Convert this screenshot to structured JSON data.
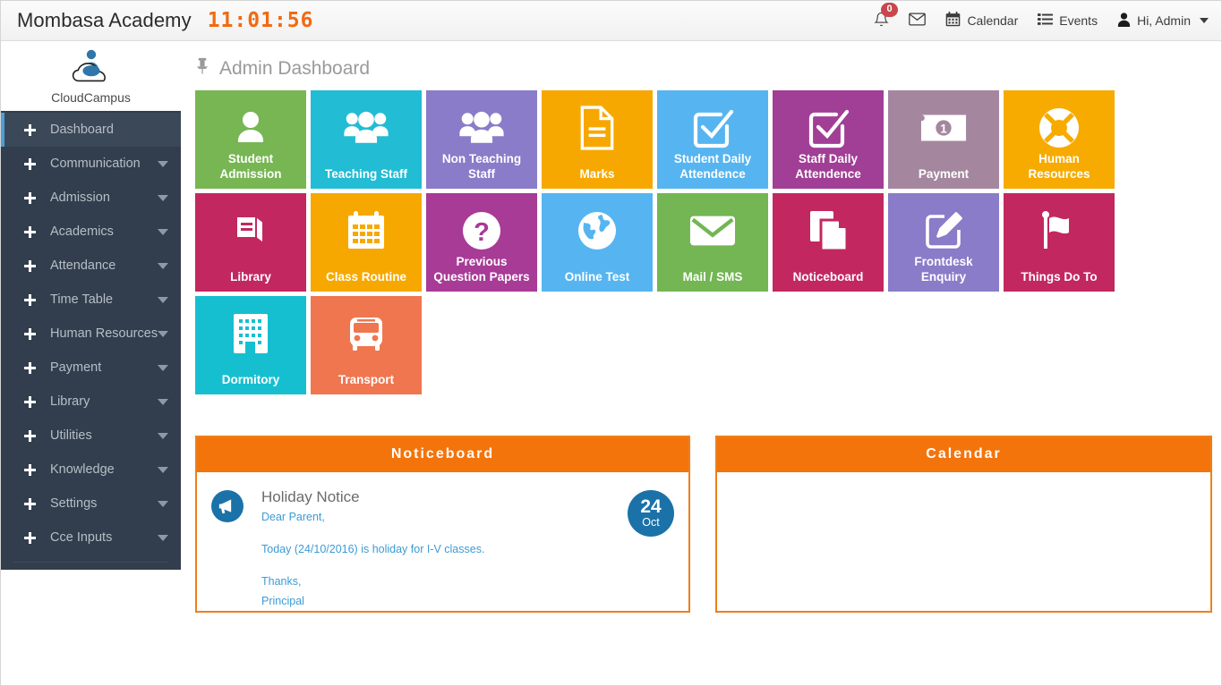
{
  "header": {
    "brand": "Mombasa Academy",
    "clock": "11:01:56",
    "notifications_count": "0",
    "notifications_icon": "bell-icon",
    "mail_icon": "envelope-icon",
    "calendar_label": "Calendar",
    "calendar_icon": "calendar-icon",
    "events_label": "Events",
    "events_icon": "list-icon",
    "user_label": "Hi, Admin",
    "user_icon": "user-icon"
  },
  "sidebar": {
    "logo_name": "CloudCampus",
    "logo_icon": "cloudcampus-logo-icon",
    "items": [
      {
        "label": "Dashboard",
        "active": true,
        "caret": false
      },
      {
        "label": "Communication",
        "active": false,
        "caret": true
      },
      {
        "label": "Admission",
        "active": false,
        "caret": true
      },
      {
        "label": "Academics",
        "active": false,
        "caret": true
      },
      {
        "label": "Attendance",
        "active": false,
        "caret": true
      },
      {
        "label": "Time Table",
        "active": false,
        "caret": true
      },
      {
        "label": "Human Resources",
        "active": false,
        "caret": true
      },
      {
        "label": "Payment",
        "active": false,
        "caret": true
      },
      {
        "label": "Library",
        "active": false,
        "caret": true
      },
      {
        "label": "Utilities",
        "active": false,
        "caret": true
      },
      {
        "label": "Knowledge",
        "active": false,
        "caret": true
      },
      {
        "label": "Settings",
        "active": false,
        "caret": true
      },
      {
        "label": "Cce Inputs",
        "active": false,
        "caret": true
      }
    ]
  },
  "main": {
    "page_title": "Admin Dashboard",
    "page_title_icon": "pin-icon",
    "tiles": [
      {
        "label": "Student Admission",
        "color": "#77b653",
        "icon": "user-icon"
      },
      {
        "label": "Teaching Staff",
        "color": "#22bcd4",
        "icon": "group-icon"
      },
      {
        "label": "Non Teaching Staff",
        "color": "#8a7cc8",
        "icon": "group-icon"
      },
      {
        "label": "Marks",
        "color": "#f7a800",
        "icon": "document-icon"
      },
      {
        "label": "Student Daily Attendence",
        "color": "#56b5f0",
        "icon": "checkbox-icon"
      },
      {
        "label": "Staff Daily Attendence",
        "color": "#a13e95",
        "icon": "checkbox-icon"
      },
      {
        "label": "Payment",
        "color": "#a4879f",
        "icon": "banknote-icon"
      },
      {
        "label": "Human Resources",
        "color": "#f7ab00",
        "icon": "lifebuoy-icon"
      },
      {
        "label": "Library",
        "color": "#c2285f",
        "icon": "book-icon"
      },
      {
        "label": "Class Routine",
        "color": "#f7a800",
        "icon": "calendar-icon"
      },
      {
        "label": "Previous Question Papers",
        "color": "#a73b96",
        "icon": "question-icon"
      },
      {
        "label": "Online Test",
        "color": "#56b5f0",
        "icon": "globe-icon"
      },
      {
        "label": "Mail / SMS",
        "color": "#73b653",
        "icon": "envelope-icon"
      },
      {
        "label": "Noticeboard",
        "color": "#c2285f",
        "icon": "copy-icon"
      },
      {
        "label": "Frontdesk Enquiry",
        "color": "#8a7cc8",
        "icon": "edit-icon"
      },
      {
        "label": "Things Do To",
        "color": "#c2285f",
        "icon": "flag-icon"
      },
      {
        "label": "Dormitory",
        "color": "#16bfd0",
        "icon": "building-icon"
      },
      {
        "label": "Transport",
        "color": "#f0764f",
        "icon": "bus-icon"
      }
    ],
    "noticeboard": {
      "title": "Noticeboard",
      "icon": "megaphone-icon",
      "notice_title": "Holiday Notice",
      "notice_greeting": "Dear Parent,",
      "notice_body": "Today (24/10/2016) is holiday for I-V classes.",
      "notice_thanks": "Thanks,",
      "notice_signature": "Principal",
      "date_day": "24",
      "date_month": "Oct"
    },
    "calendar": {
      "title": "Calendar"
    }
  },
  "colors": {
    "accent_orange": "#f4740c",
    "clock_orange": "#f26a10",
    "sidebar_dark": "#323e4d",
    "active_blue": "#4d9fd4",
    "badge_red": "#c9474b",
    "notice_blue": "#1a72a8"
  }
}
